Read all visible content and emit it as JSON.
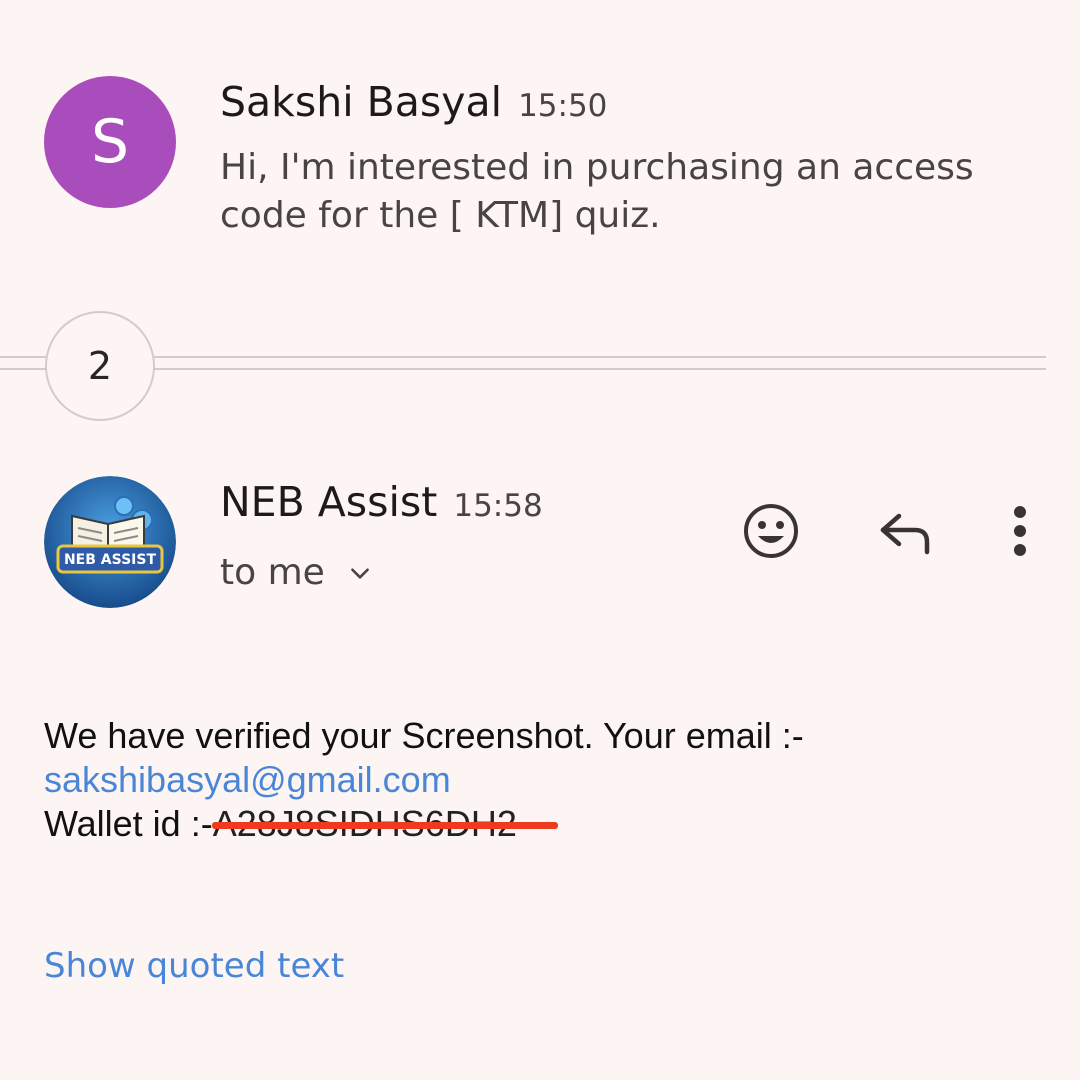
{
  "messages": [
    {
      "avatar_letter": "S",
      "avatar_color": "#a94cbc",
      "sender": "Sakshi Basyal",
      "time": "15:50",
      "snippet": "Hi, I'm interested in purchasing an access code for the [ KTM] quiz."
    },
    {
      "avatar_icon": "neb-assist-logo-icon",
      "avatar_logo_text": "NEB ASSIST",
      "sender": "NEB Assist",
      "time": "15:58",
      "recipient": "to me",
      "body": {
        "line1": "We have verified your Screenshot. Your email :-",
        "email": "sakshibasyal@gmail.com",
        "wallet_label": "Wallet id :-",
        "wallet_value": "A28J8SIDHS6DH2"
      },
      "show_quoted": "Show quoted text"
    }
  ],
  "collapsed_count": "2",
  "icons": {
    "emoji": "add-reaction-icon",
    "reply": "reply-icon",
    "more": "more-vert-icon",
    "expand": "chevron-down-icon"
  },
  "colors": {
    "background": "#fdf5f3",
    "link": "#4a86d8",
    "redaction": "#ee3a1e"
  }
}
